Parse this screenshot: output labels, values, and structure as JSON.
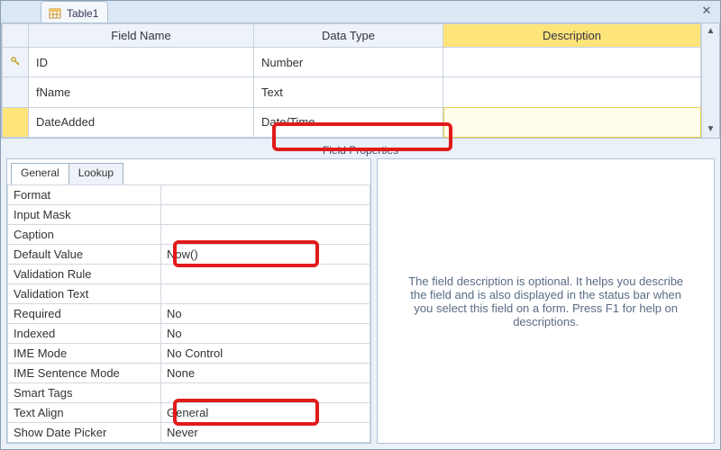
{
  "window": {
    "tab_title": "Table1",
    "close_glyph": "✕"
  },
  "grid": {
    "headers": {
      "field_name": "Field Name",
      "data_type": "Data Type",
      "description": "Description"
    },
    "rows": [
      {
        "key": true,
        "name": "ID",
        "type": "Number",
        "desc": ""
      },
      {
        "key": false,
        "name": "fName",
        "type": "Text",
        "desc": ""
      },
      {
        "key": false,
        "name": "DateAdded",
        "type": "Date/Time",
        "desc": "",
        "active": true
      }
    ],
    "scroll": {
      "up": "▲",
      "down": "▼"
    }
  },
  "props_label": "Field Properties",
  "prop_tabs": {
    "general": "General",
    "lookup": "Lookup",
    "active": "general"
  },
  "properties": [
    {
      "label": "Format",
      "value": ""
    },
    {
      "label": "Input Mask",
      "value": ""
    },
    {
      "label": "Caption",
      "value": ""
    },
    {
      "label": "Default Value",
      "value": "Now()"
    },
    {
      "label": "Validation Rule",
      "value": ""
    },
    {
      "label": "Validation Text",
      "value": ""
    },
    {
      "label": "Required",
      "value": "No"
    },
    {
      "label": "Indexed",
      "value": "No"
    },
    {
      "label": "IME Mode",
      "value": "No Control"
    },
    {
      "label": "IME Sentence Mode",
      "value": "None"
    },
    {
      "label": "Smart Tags",
      "value": ""
    },
    {
      "label": "Text Align",
      "value": "General"
    },
    {
      "label": "Show Date Picker",
      "value": "Never"
    }
  ],
  "help_text": "The field description is optional. It helps you describe the field and is also displayed in the status bar when you select this field on a form. Press F1 for help on descriptions."
}
